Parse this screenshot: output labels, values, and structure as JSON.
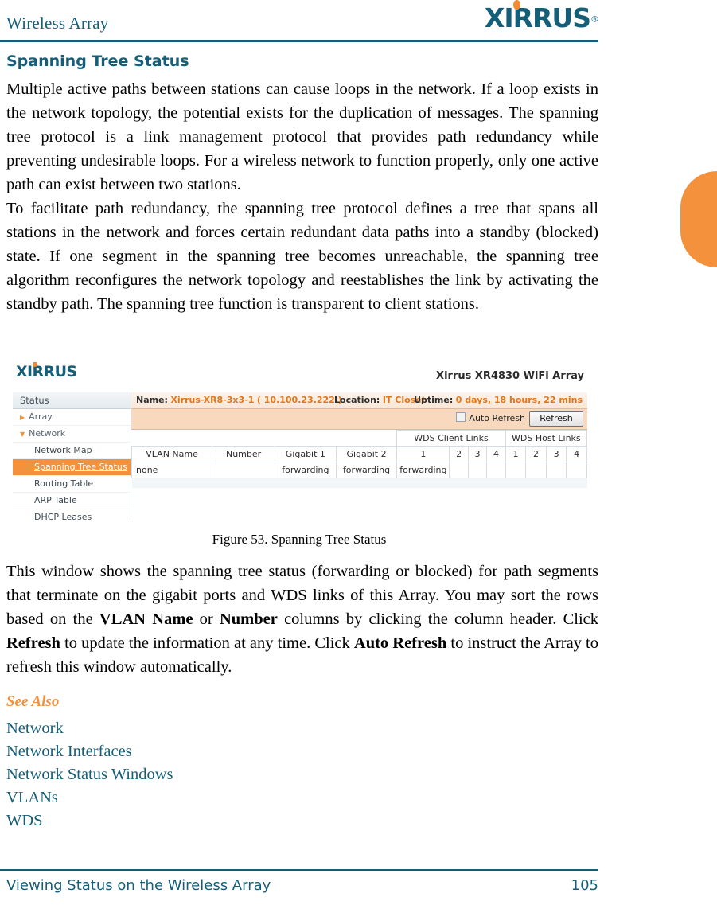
{
  "header": {
    "title": "Wireless Array",
    "logo_word": "XIRRUS",
    "logo_reg": "®"
  },
  "section": {
    "heading": "Spanning Tree Status",
    "paragraph_1": "Multiple active paths between stations can cause loops in the network. If a loop exists in the network topology, the potential exists for the duplication of messages. The spanning tree protocol is a link management protocol that provides path redundancy while preventing undesirable loops. For a wireless network to function properly, only one active path can exist between two stations.",
    "paragraph_2": "To facilitate path redundancy, the spanning tree protocol defines a tree that spans all stations in the network and forces certain redundant data paths into a standby (blocked) state. If one segment in the spanning tree becomes unreachable, the spanning tree algorithm reconfigures the network topology and reestablishes the link by activating the standby path. The spanning tree function is transparent to client stations."
  },
  "figure": {
    "caption": "Figure 53. Spanning Tree Status",
    "logo_word": "XIRRUS",
    "product_name": "Xirrus XR4830 WiFi Array",
    "sidebar": {
      "title": "Status",
      "groups": [
        {
          "label": "Array",
          "arrow": "▶",
          "expanded": false
        },
        {
          "label": "Network",
          "arrow": "▼",
          "expanded": true
        }
      ],
      "items": [
        {
          "label": "Network Map",
          "selected": false
        },
        {
          "label": "Spanning Tree Status",
          "selected": true
        },
        {
          "label": "Routing Table",
          "selected": false
        },
        {
          "label": "ARP Table",
          "selected": false
        },
        {
          "label": "DHCP Leases",
          "selected": false
        }
      ]
    },
    "infobar": {
      "name_key": "Name:",
      "name_value": "Xirrus-XR8-3x3-1",
      "name_ip": "( 10.100.23.222 )",
      "location_key": "Location:",
      "location_value": "IT Closet",
      "uptime_key": "Uptime:",
      "uptime_value": "0 days, 18 hours, 22 mins"
    },
    "actionbar": {
      "auto_refresh_label": "Auto Refresh",
      "auto_refresh_checked": false,
      "refresh_button_label": "Refresh"
    },
    "table": {
      "group_headers": [
        {
          "label": "",
          "span": 4
        },
        {
          "label": "WDS Client Links",
          "span": 4
        },
        {
          "label": "WDS Host Links",
          "span": 4
        }
      ],
      "columns": [
        "VLAN Name",
        "Number",
        "Gigabit 1",
        "Gigabit 2",
        "1",
        "2",
        "3",
        "4",
        "1",
        "2",
        "3",
        "4"
      ],
      "rows": [
        [
          "none",
          "",
          "forwarding",
          "forwarding",
          "forwarding",
          "",
          "",
          "",
          "",
          "",
          "",
          ""
        ]
      ]
    }
  },
  "body": {
    "paragraph_3_parts": [
      {
        "text": "This window shows the spanning tree status (forwarding or blocked) for path segments that terminate on the gigabit ports and WDS links of this Array. You may sort the rows based on the ",
        "bold": false
      },
      {
        "text": "VLAN Name",
        "bold": true
      },
      {
        "text": " or ",
        "bold": false
      },
      {
        "text": "Number",
        "bold": true
      },
      {
        "text": " columns by clicking the column header. Click ",
        "bold": false
      },
      {
        "text": "Refresh",
        "bold": true
      },
      {
        "text": " to update the information at any time. Click ",
        "bold": false
      },
      {
        "text": "Auto Refresh",
        "bold": true
      },
      {
        "text": " to instruct the Array to refresh this window automatically.",
        "bold": false
      }
    ]
  },
  "see_also": {
    "heading": "See Also",
    "links": [
      "Network",
      "Network Interfaces",
      "Network Status Windows",
      "VLANs",
      "WDS"
    ]
  },
  "footer": {
    "title": "Viewing Status on the Wireless Array",
    "page_number": "105"
  },
  "colors": {
    "brand_teal": "#155e78",
    "brand_orange": "#f3913c",
    "value_orange": "#e2761b",
    "action_bar": "#f8d9be"
  }
}
